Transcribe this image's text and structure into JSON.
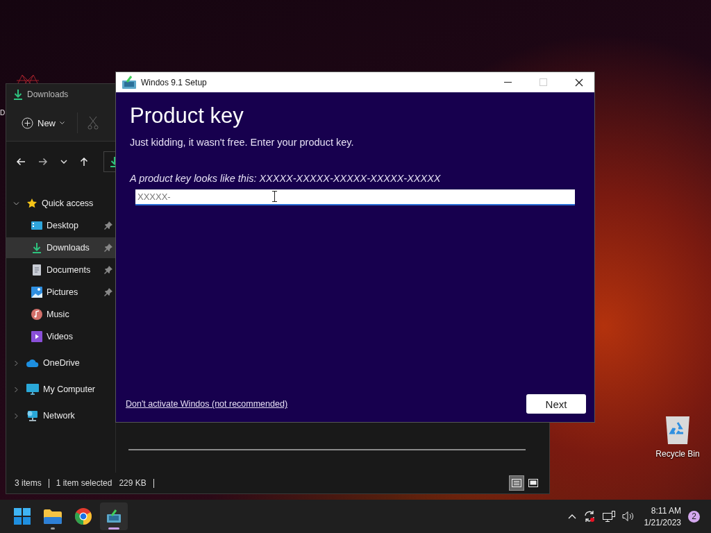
{
  "desktop": {
    "cut_label": "D",
    "icons": [
      {
        "kind": "recycle-bin",
        "label": "Recycle Bin"
      }
    ]
  },
  "explorer": {
    "title": "Downloads",
    "new_button": "New",
    "cut_disabled": true,
    "sidebar": [
      {
        "label": "Quick access",
        "kind": "star",
        "expanded": true,
        "selected": false,
        "children": [
          {
            "label": "Desktop",
            "kind": "desktop",
            "pinned": true,
            "selected": false
          },
          {
            "label": "Downloads",
            "kind": "download",
            "pinned": true,
            "selected": true
          },
          {
            "label": "Documents",
            "kind": "document",
            "pinned": true,
            "selected": false
          },
          {
            "label": "Pictures",
            "kind": "picture",
            "pinned": true,
            "selected": false
          },
          {
            "label": "Music",
            "kind": "music",
            "pinned": false,
            "selected": false
          },
          {
            "label": "Videos",
            "kind": "video",
            "pinned": false,
            "selected": false
          }
        ]
      },
      {
        "label": "OneDrive",
        "kind": "cloud",
        "expanded": false,
        "selected": false
      },
      {
        "label": "My Computer",
        "kind": "monitor",
        "expanded": false,
        "selected": false
      },
      {
        "label": "Network",
        "kind": "network",
        "expanded": false,
        "selected": false
      }
    ],
    "status": [
      "3 items",
      "1 item selected",
      "229 KB"
    ],
    "views": [
      {
        "kind": "details",
        "selected": true
      },
      {
        "kind": "tiles",
        "selected": false
      }
    ]
  },
  "setup": {
    "title": "Windos 9.1 Setup",
    "heading": "Product key",
    "subtitle": "Just kidding, it wasn't free. Enter your product key.",
    "hint": "A product key looks like this: XXXXX-XXXXX-XXXXX-XXXXX-XXXXX",
    "key_value": "XXXXX-",
    "skip_link": "Don't activate Windos (not recommended)",
    "next_button": "Next"
  },
  "taskbar": {
    "apps": [
      {
        "kind": "start",
        "running": false,
        "active": false
      },
      {
        "kind": "explorer",
        "running": true,
        "active": false
      },
      {
        "kind": "chrome",
        "running": false,
        "active": false
      },
      {
        "kind": "setup",
        "running": true,
        "active": true
      }
    ],
    "time": "8:11 AM",
    "date": "1/21/2023",
    "notifications": "2"
  }
}
